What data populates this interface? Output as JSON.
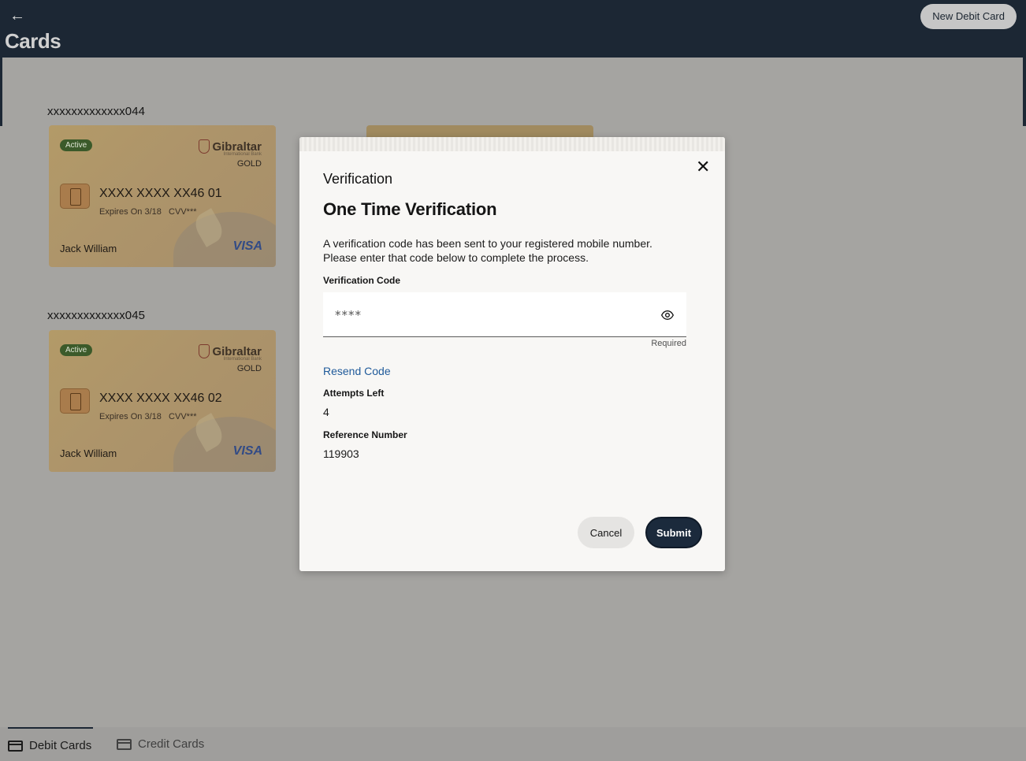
{
  "header": {
    "back_icon": "arrow-left-icon",
    "title": "Cards",
    "new_card_label": "New Debit Card"
  },
  "cards": [
    {
      "account": "xxxxxxxxxxxxx044",
      "status": "Active",
      "bank_name": "Gibraltar",
      "bank_sub": "International Bank",
      "tier": "GOLD",
      "number": "XXXX XXXX XX46 01",
      "expiry": "Expires On 3/18",
      "cvv": "CVV***",
      "holder": "Jack William",
      "network": "VISA"
    },
    {
      "account": "xxxxxxxxxxxxx045",
      "status": "Active",
      "bank_name": "Gibraltar",
      "bank_sub": "International Bank",
      "tier": "GOLD",
      "number": "XXXX XXXX XX46 02",
      "expiry": "Expires On 3/18",
      "cvv": "CVV***",
      "holder": "Jack William",
      "network": "VISA"
    }
  ],
  "modal": {
    "header": "Verification",
    "title": "One Time Verification",
    "description": "A verification code has been sent to your registered mobile number. Please enter that code below to complete the process.",
    "code_label": "Verification Code",
    "code_placeholder": "****",
    "required_hint": "Required",
    "resend_label": "Resend Code",
    "attempts_label": "Attempts Left",
    "attempts_value": "4",
    "reference_label": "Reference Number",
    "reference_value": "119903",
    "cancel_label": "Cancel",
    "submit_label": "Submit"
  },
  "tabs": [
    {
      "label": "Debit Cards",
      "icon": "card-icon",
      "active": true
    },
    {
      "label": "Credit Cards",
      "icon": "card-icon",
      "active": false
    }
  ],
  "colors": {
    "header_bg": "#1c2734",
    "overlay_bg": "#a5a4a1",
    "card_gold": "#b39a68",
    "status_green": "#3b5a2a",
    "link_blue": "#1f5a9a",
    "submit_bg": "#1b2a3c"
  }
}
